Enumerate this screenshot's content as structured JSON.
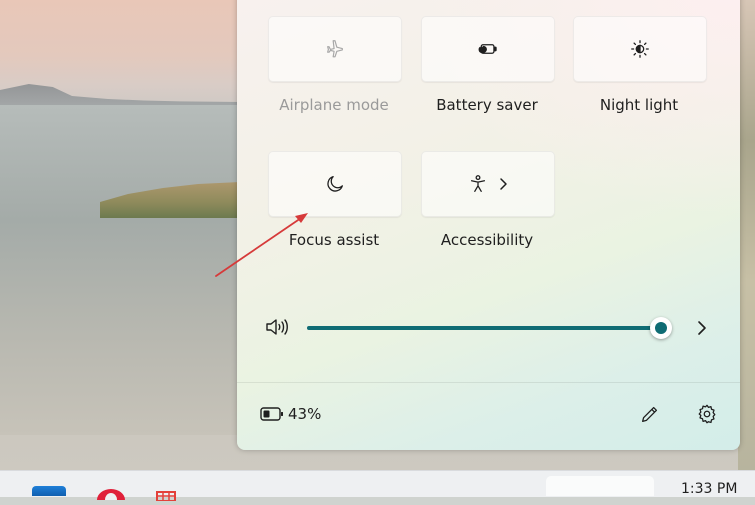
{
  "quick_settings": {
    "tiles": [
      {
        "id": "airplane",
        "label": "Airplane mode",
        "icon": "airplane-icon",
        "enabled": false
      },
      {
        "id": "battery",
        "label": "Battery saver",
        "icon": "battery-saver-icon",
        "enabled": true
      },
      {
        "id": "night",
        "label": "Night light",
        "icon": "night-light-icon",
        "enabled": true
      },
      {
        "id": "focus",
        "label": "Focus assist",
        "icon": "moon-icon",
        "enabled": true
      },
      {
        "id": "access",
        "label": "Accessibility",
        "icon": "accessibility-icon",
        "enabled": true
      }
    ],
    "volume": {
      "level_percent": 100,
      "icon": "speaker-icon",
      "chevron": "chevron-right-icon"
    },
    "footer": {
      "battery_percent": "43%",
      "battery_icon": "battery-icon",
      "edit_icon": "pencil-icon",
      "settings_icon": "gear-icon"
    }
  },
  "taskbar": {
    "time": "1:33 PM"
  },
  "colors": {
    "accent": "#0f6c74",
    "annotation_arrow": "#d63a3a"
  }
}
